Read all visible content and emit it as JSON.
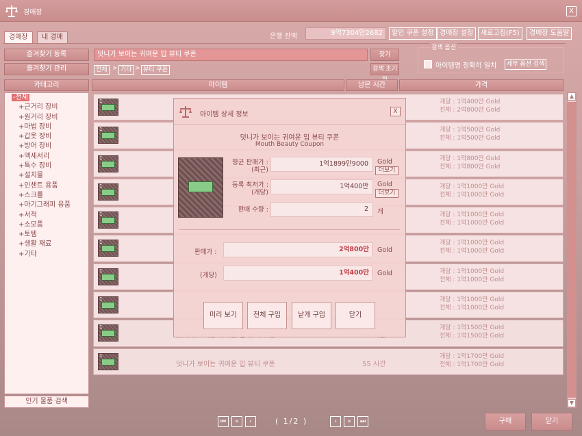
{
  "window": {
    "title": "경매장",
    "close": "X"
  },
  "tabs": [
    "경매장",
    "내 경매"
  ],
  "bank": {
    "label": "은행 잔액",
    "value": "9억7304만2682"
  },
  "top_buttons": [
    "할인 쿠폰 설정",
    "경매장 설정",
    "새로고침(F5)",
    "경매장 도움말"
  ],
  "left_buttons": {
    "favorite_add": "즐겨찾기 등록",
    "favorite_manage": "즐겨찾기 관리"
  },
  "search": {
    "value": "덧니가 보이는 귀여운 입 뷰티 쿠폰",
    "find": "찾기",
    "reset": "검색 초기화",
    "breadcrumb": [
      "전체",
      "기타",
      "뷰티 쿠폰"
    ]
  },
  "options": {
    "title": "검색 옵션",
    "exact_label": "아이템명 정확히 일치",
    "detail_button": "세부 옵션 검색"
  },
  "columns": {
    "category": "카테고리",
    "item": "아이템",
    "time": "남은 시간",
    "price": "가격"
  },
  "categories": [
    "-전체",
    "+근거리 장비",
    "+원거리 장비",
    "+마법 장비",
    "+갑옷 장비",
    "+방어 장비",
    "+액세서리",
    "+특수 장비",
    "+설치물",
    "+인챈트 용품",
    "+스크롤",
    "+마기그래피 용품",
    "+서적",
    "+소모품",
    "+토템",
    "+생활 재료",
    "+기타"
  ],
  "popular_search": "인기 물품 검색",
  "rows": [
    {
      "n": "1",
      "name": "",
      "time": "",
      "unit": "개당 : 1억400만 Gold",
      "total": "전체 : 2억800만 Gold"
    },
    {
      "n": "1",
      "name": "",
      "time": "",
      "unit": "개당 : 1억500만 Gold",
      "total": "전체 : 1억500만 Gold"
    },
    {
      "n": "1",
      "name": "",
      "time": "",
      "unit": "개당 : 1억800만 Gold",
      "total": "전체 : 1억800만 Gold"
    },
    {
      "n": "1",
      "name": "",
      "time": "",
      "unit": "개당 : 1억1000만 Gold",
      "total": "전체 : 1억1000만 Gold"
    },
    {
      "n": "1",
      "name": "",
      "time": "",
      "unit": "개당 : 1억1000만 Gold",
      "total": "전체 : 1억1000만 Gold"
    },
    {
      "n": "1",
      "name": "",
      "time": "",
      "unit": "개당 : 1억1000만 Gold",
      "total": "전체 : 1억1000만 Gold"
    },
    {
      "n": "1",
      "name": "",
      "time": "",
      "unit": "개당 : 1억1000만 Gold",
      "total": "전체 : 1억1000만 Gold"
    },
    {
      "n": "1",
      "name": "",
      "time": "",
      "unit": "개당 : 1억1000만 Gold",
      "total": "전체 : 1억1000만 Gold"
    },
    {
      "n": "1",
      "name": "덧니가 보이는 귀여운 입 뷰티 쿠폰",
      "time": "56 시간",
      "unit": "개당 : 1억1500만 Gold",
      "total": "전체 : 1억1500만 Gold"
    },
    {
      "n": "1",
      "name": "덧니가 보이는 귀여운 입 뷰티 쿠폰",
      "time": "55 시간",
      "unit": "개당 : 1억1700만 Gold",
      "total": "전체 : 1억1700만 Gold"
    }
  ],
  "pagination": {
    "text": "1/2"
  },
  "footer": {
    "buy": "구매",
    "close": "닫기"
  },
  "modal": {
    "title": "아이템 상세 정보",
    "close": "X",
    "item_name": "덧니가 보이는 귀여운 입 뷰티 쿠폰",
    "item_name_en": "Mouth Beauty Coupon",
    "avg_label": "평균 판매가 :\n(최근)",
    "avg_value": "1억1899만9000",
    "min_label": "등록 최저가 :\n(개당)",
    "min_value": "1억400만",
    "qty_label": "판매 수량 :",
    "qty_value": "2",
    "gold": "Gold",
    "count_unit": "개",
    "more": "더보기",
    "sell_label": "판매가 :",
    "sell_value": "2억800만",
    "each_label": "(개당)",
    "each_value": "1억400만",
    "buttons": [
      "미리 보기",
      "전체 구입",
      "낱개 구입",
      "닫기"
    ]
  }
}
